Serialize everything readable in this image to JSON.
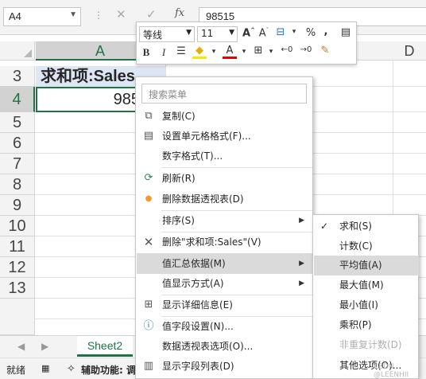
{
  "formula_bar": {
    "name_box": "A4",
    "cancel": "✕",
    "enter": "✓",
    "fx": "fx",
    "value": "98515"
  },
  "columns": [
    "A",
    "D"
  ],
  "rows": [
    "3",
    "4",
    "5",
    "6",
    "7",
    "8",
    "9",
    "10",
    "11",
    "12",
    "13"
  ],
  "cells": {
    "a3": "求和项:Sales",
    "a4": "985"
  },
  "mini_toolbar": {
    "font": "等线",
    "size": "11",
    "percent": "%",
    "comma": ",",
    "bold": "B",
    "italic": "I"
  },
  "context_menu": {
    "search_placeholder": "搜索菜单",
    "items": [
      {
        "label": "复制(C)"
      },
      {
        "label": "设置单元格格式(F)..."
      },
      {
        "label": "数字格式(T)..."
      },
      {
        "label": "刷新(R)"
      },
      {
        "label": "删除数据透视表(D)"
      },
      {
        "label": "排序(S)"
      },
      {
        "label": "删除\"求和项:Sales\"(V)"
      },
      {
        "label": "值汇总依据(M)"
      },
      {
        "label": "值显示方式(A)"
      },
      {
        "label": "显示详细信息(E)"
      },
      {
        "label": "值字段设置(N)..."
      },
      {
        "label": "数据透视表选项(O)..."
      },
      {
        "label": "显示字段列表(D)"
      }
    ]
  },
  "submenu": {
    "items": [
      {
        "label": "求和(S)",
        "checked": "✓"
      },
      {
        "label": "计数(C)"
      },
      {
        "label": "平均值(A)"
      },
      {
        "label": "最大值(M)"
      },
      {
        "label": "最小值(I)"
      },
      {
        "label": "乘积(P)"
      },
      {
        "label": "非重复计数(D)"
      },
      {
        "label": "其他选项(O)..."
      }
    ]
  },
  "sheet_tab": "Sheet2",
  "status": {
    "ready": "就绪",
    "accessibility": "辅助功能: 调"
  },
  "watermark": "CSDN @LEENHII",
  "colors": {
    "accent": "#217346",
    "selection": "#dde7f4",
    "hover": "#dadada"
  }
}
